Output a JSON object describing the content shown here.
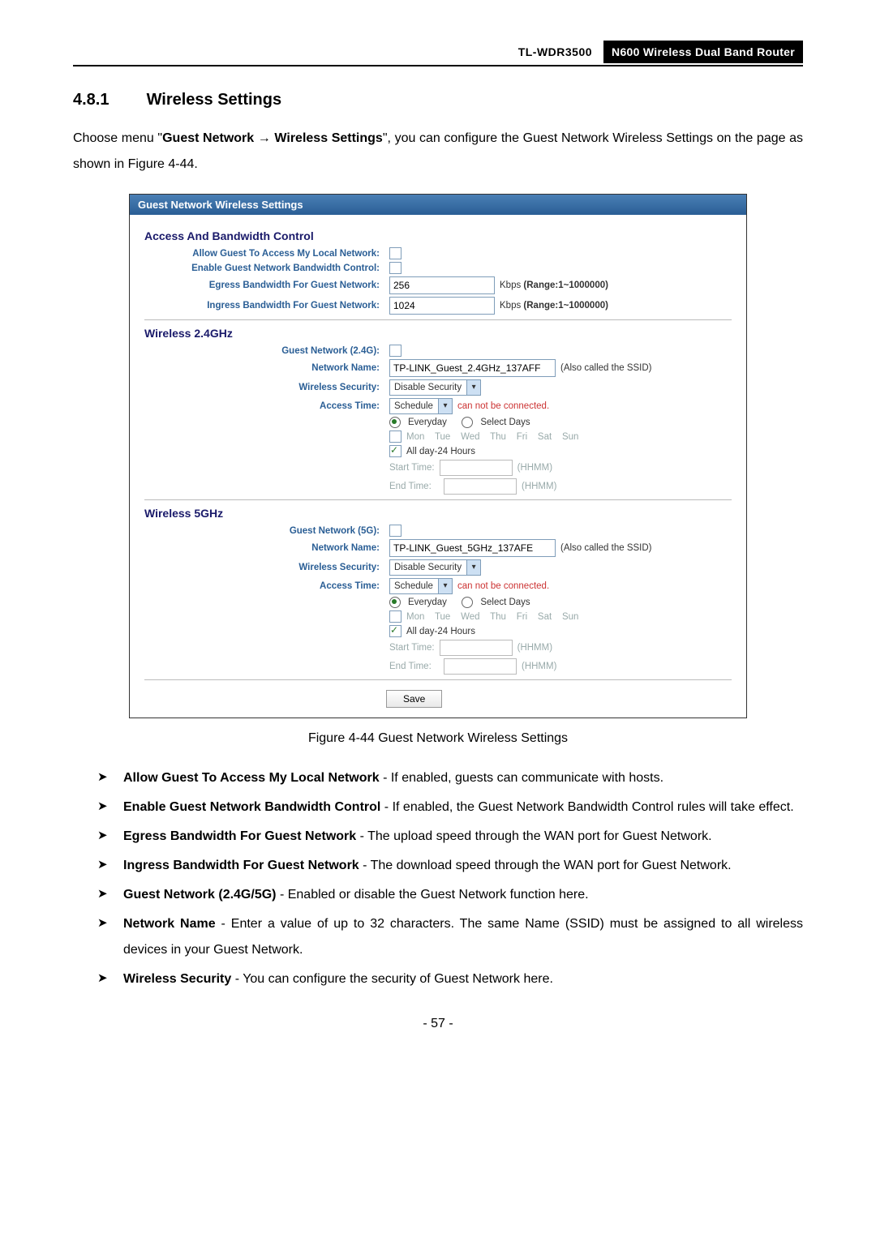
{
  "header": {
    "model": "TL-WDR3500",
    "product": "N600 Wireless Dual Band Router"
  },
  "section": {
    "number": "4.8.1",
    "title": "Wireless Settings"
  },
  "intro": {
    "prefix": "Choose menu \"",
    "menu1": "Guest Network",
    "arrow": " → ",
    "menu2": "Wireless Settings",
    "suffix": "\", you can configure the Guest Network Wireless Settings on the page as shown in Figure 4-44."
  },
  "panel": {
    "title": "Guest Network Wireless Settings",
    "bw": {
      "heading": "Access And Bandwidth Control",
      "allow_label": "Allow Guest To Access My Local Network:",
      "enable_bw_label": "Enable Guest Network Bandwidth Control:",
      "egress_label": "Egress Bandwidth For Guest Network:",
      "egress_value": "256",
      "egress_unit_prefix": "Kbps  ",
      "egress_unit_bold": "(Range:1~1000000)",
      "ingress_label": "Ingress Bandwidth For Guest Network:",
      "ingress_value": "1024",
      "ingress_unit_prefix": "Kbps  ",
      "ingress_unit_bold": "(Range:1~1000000)"
    },
    "w24": {
      "heading": "Wireless 2.4GHz",
      "enable_label": "Guest Network (2.4G):",
      "name_label": "Network Name:",
      "name_value": "TP-LINK_Guest_2.4GHz_137AFF",
      "name_hint": "(Also called the SSID)",
      "sec_label": "Wireless Security:",
      "sec_value": "Disable Security",
      "acc_label": "Access Time:",
      "schedule": "Schedule",
      "cannot": "can not be connected.",
      "everyday": "Everyday",
      "selectdays": "Select Days",
      "days": "Mon    Tue    Wed    Thu    Fri    Sat    Sun",
      "allday": "All day-24 Hours",
      "start": "Start Time:",
      "end": "End Time:",
      "hhmm": "(HHMM)"
    },
    "w5": {
      "heading": "Wireless 5GHz",
      "enable_label": "Guest Network (5G):",
      "name_label": "Network Name:",
      "name_value": "TP-LINK_Guest_5GHz_137AFE",
      "name_hint": "(Also called the SSID)",
      "sec_label": "Wireless Security:",
      "sec_value": "Disable Security",
      "acc_label": "Access Time:",
      "schedule": "Schedule",
      "cannot": "can not be connected.",
      "everyday": "Everyday",
      "selectdays": "Select Days",
      "days": "Mon    Tue    Wed    Thu    Fri    Sat    Sun",
      "allday": "All day-24 Hours",
      "start": "Start Time:",
      "end": "End Time:",
      "hhmm": "(HHMM)"
    },
    "save": "Save"
  },
  "caption": "Figure 4-44 Guest Network Wireless Settings",
  "bullets": {
    "b1_bold": "Allow Guest To Access My Local Network",
    "b1_rest": " - If enabled, guests can communicate with hosts.",
    "b2_bold": "Enable Guest Network Bandwidth Control",
    "b2_rest": " - If enabled, the Guest Network Bandwidth Control rules will take effect.",
    "b3_bold": "Egress Bandwidth For Guest Network",
    "b3_rest": " - The upload speed through the WAN port for Guest Network.",
    "b4_bold": "Ingress Bandwidth For Guest Network",
    "b4_rest": " - The download speed through the WAN port for Guest Network.",
    "b5_bold": "Guest Network (2.4G/5G)",
    "b5_rest": " - Enabled or disable the Guest Network function here.",
    "b6_bold": "Network Name",
    "b6_rest": " - Enter a value of up to 32 characters. The same Name (SSID) must be assigned to all wireless devices in your Guest Network.",
    "b7_bold": "Wireless Security",
    "b7_rest": " - You can configure the security of Guest Network here."
  },
  "pagenum": "- 57 -"
}
